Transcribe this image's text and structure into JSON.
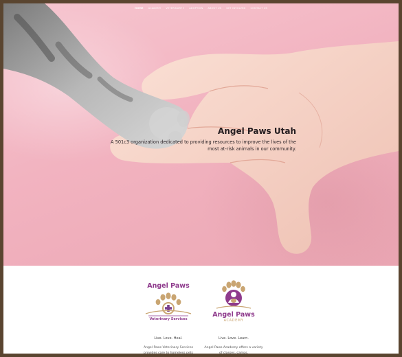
{
  "nav": {
    "items": [
      {
        "label": "HOME",
        "active": true
      },
      {
        "label": "ACADEMY"
      },
      {
        "label": "VETERINARY"
      },
      {
        "label": "ADOPTION"
      },
      {
        "label": "ABOUT US"
      },
      {
        "label": "GET INVOLVED"
      },
      {
        "label": "CONTACT US"
      }
    ],
    "dropdown_icon": "chevron-down-icon"
  },
  "hero": {
    "title": "Angel Paws Utah",
    "subtitle": "A 501c3 organization dedicated to providing resources to improve the lives of the most at-risk animals in our community."
  },
  "cards": {
    "vet": {
      "logo_title": "Angel Paws",
      "logo_subtitle": "Veterinary Services",
      "tagline": "Live. Love. Heal.",
      "description": "Angel Paws Veterinary Services provides care to homeless pets"
    },
    "academy": {
      "logo_title": "Angel Paws",
      "logo_subtitle": "ACADEMY",
      "tagline": "Live. Love. Learn.",
      "description": "Angel Paws Academy offers a variety of classes, camps,"
    }
  },
  "colors": {
    "brand_purple": "#8e3a8c",
    "brand_gold": "#c9a572",
    "hero_pink": "#f2b3c0",
    "frame_border": "#5a4530"
  }
}
